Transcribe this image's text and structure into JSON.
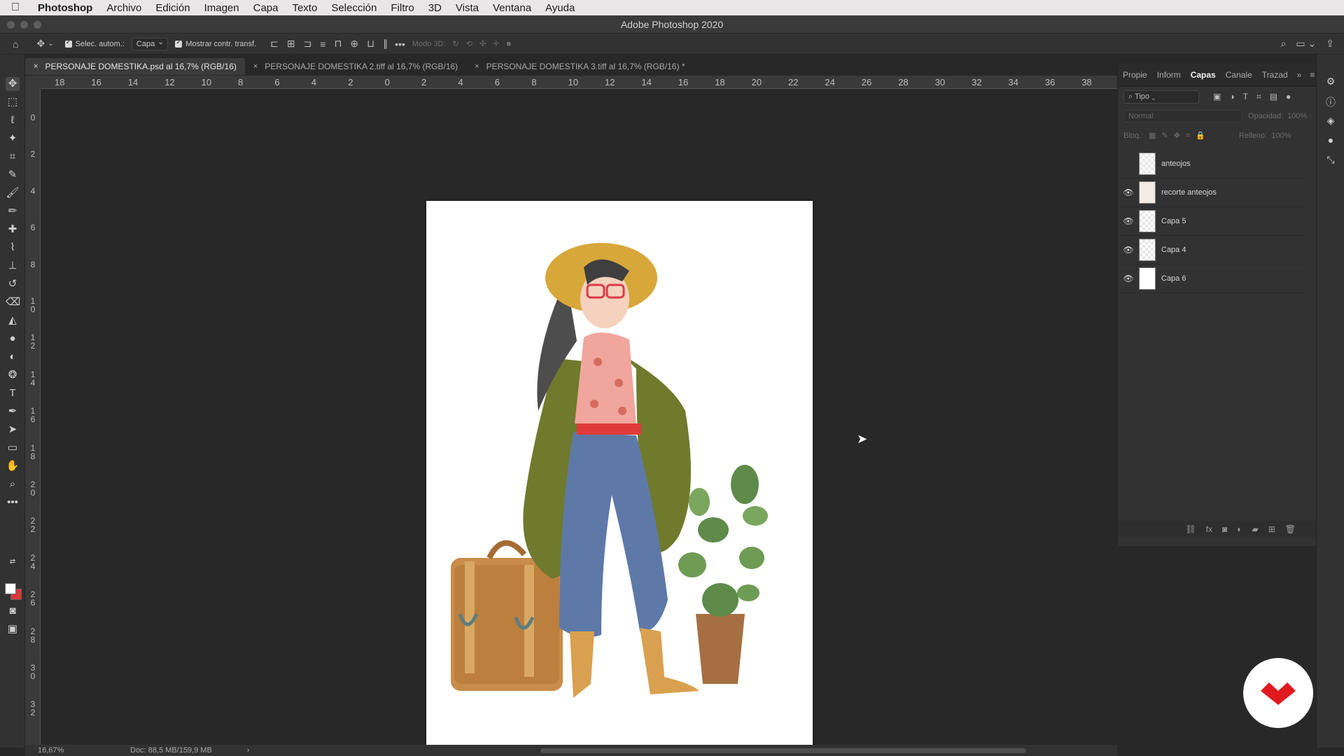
{
  "menubar": {
    "apple": "",
    "app": "Photoshop",
    "items": [
      "Archivo",
      "Edición",
      "Imagen",
      "Capa",
      "Texto",
      "Selección",
      "Filtro",
      "3D",
      "Vista",
      "Ventana",
      "Ayuda"
    ]
  },
  "window": {
    "title": "Adobe Photoshop 2020"
  },
  "options": {
    "auto_select_label": "Selec. autom.:",
    "auto_select_value": "Capa",
    "transform_label": "Mostrar contr. transf.",
    "mode3d_label": "Modo 3D:"
  },
  "tabs": [
    {
      "label": "PERSONAJE DOMESTIKA.psd al 16,7% (RGB/16)",
      "active": true
    },
    {
      "label": "PERSONAJE DOMESTIKA 2.tiff al 16,7% (RGB/16)",
      "active": false
    },
    {
      "label": "PERSONAJE DOMESTIKA 3.tiff al 16,7% (RGB/16) *",
      "active": false
    }
  ],
  "ruler_h": [
    "18",
    "16",
    "14",
    "12",
    "10",
    "8",
    "6",
    "4",
    "2",
    "0",
    "2",
    "4",
    "6",
    "8",
    "10",
    "12",
    "14",
    "16",
    "18",
    "20",
    "22",
    "24",
    "26",
    "28",
    "30",
    "32",
    "34",
    "36",
    "38"
  ],
  "ruler_v": [
    "0",
    "2",
    "4",
    "6",
    "8",
    "10",
    "12",
    "14",
    "16",
    "18",
    "20",
    "22",
    "24",
    "26",
    "28",
    "30",
    "32"
  ],
  "status": {
    "zoom": "16,67%",
    "doc": "Doc: 88,5 MB/159,9 MB",
    "arrow": "›"
  },
  "panel": {
    "tabs": [
      "Propie",
      "Inform",
      "Capas",
      "Canale",
      "Trazad"
    ],
    "active_tab": "Capas",
    "filter_label": "Tipo",
    "blend_mode": "Normal",
    "opacity_label": "Opacidad:",
    "opacity_value": "100%",
    "lock_label": "Bloq.:",
    "fill_label": "Relleno:",
    "fill_value": "100%",
    "layers": [
      {
        "name": "anteojos",
        "visible": false,
        "thumb": "transparent"
      },
      {
        "name": "recorte anteojos",
        "visible": true,
        "thumb": "figure"
      },
      {
        "name": "Capa 5",
        "visible": true,
        "thumb": "transparent"
      },
      {
        "name": "Capa 4",
        "visible": true,
        "thumb": "transparent"
      },
      {
        "name": "Capa 6",
        "visible": true,
        "thumb": "white"
      }
    ]
  },
  "colors": {
    "foreground": "#ffffff",
    "background": "#e03535",
    "badge": "#e0191f"
  }
}
